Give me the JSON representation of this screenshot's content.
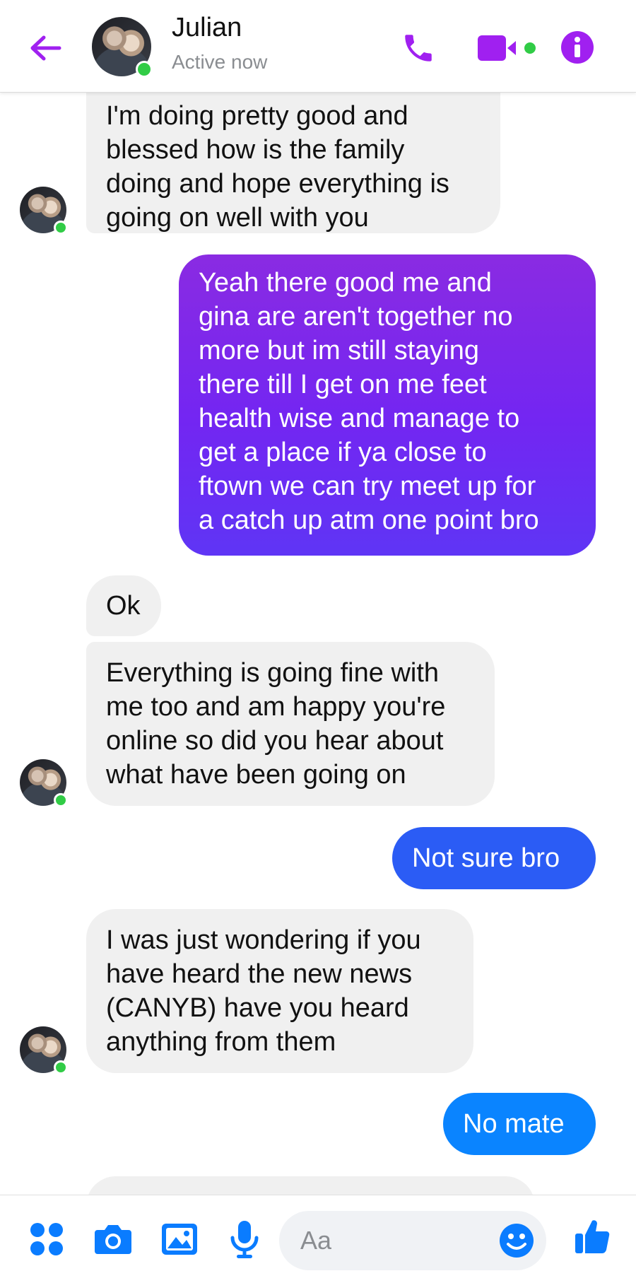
{
  "header": {
    "name": "Julian",
    "status": "Active now",
    "icons": [
      "back-arrow-icon",
      "phone-icon",
      "video-camera-icon",
      "info-icon"
    ],
    "accent_color": "#a020f0"
  },
  "messages": [
    {
      "side": "received",
      "text": "I'm doing pretty good and\nblessed how is the family\ndoing and hope everything is\ngoing on well with you"
    },
    {
      "side": "sent",
      "text": "Yeah there good me and\ngina are aren't together no\nmore but im still staying\nthere till I get on me feet\nhealth wise and manage to\nget a place if ya close to\nftown we can try meet up for\na catch up atm one point bro"
    },
    {
      "side": "received",
      "text": "Ok"
    },
    {
      "side": "received",
      "text": "Everything is going fine with\nme too and am happy you're\nonline so did you hear about\nwhat have been going on"
    },
    {
      "side": "sent",
      "text": "Not sure bro"
    },
    {
      "side": "received",
      "text": "I was just wondering if you\nhave heard the new news\n(CANYB) have you heard\nanything from them"
    },
    {
      "side": "sent",
      "text": "No mate"
    }
  ],
  "composer": {
    "placeholder": "Aa",
    "icons": [
      "apps-icon",
      "camera-icon",
      "gallery-icon",
      "microphone-icon",
      "emoji-icon",
      "thumbs-up-icon"
    ],
    "icon_color": "#0a7cff"
  },
  "colors": {
    "received_bg": "#f0f0f0",
    "sent_gradient_top": "#8a2be2",
    "sent_gradient_bottom": "#5f35f5",
    "sent_blue_1": "#2b5cf5",
    "sent_blue_2": "#0a84ff",
    "online": "#31cc46"
  }
}
